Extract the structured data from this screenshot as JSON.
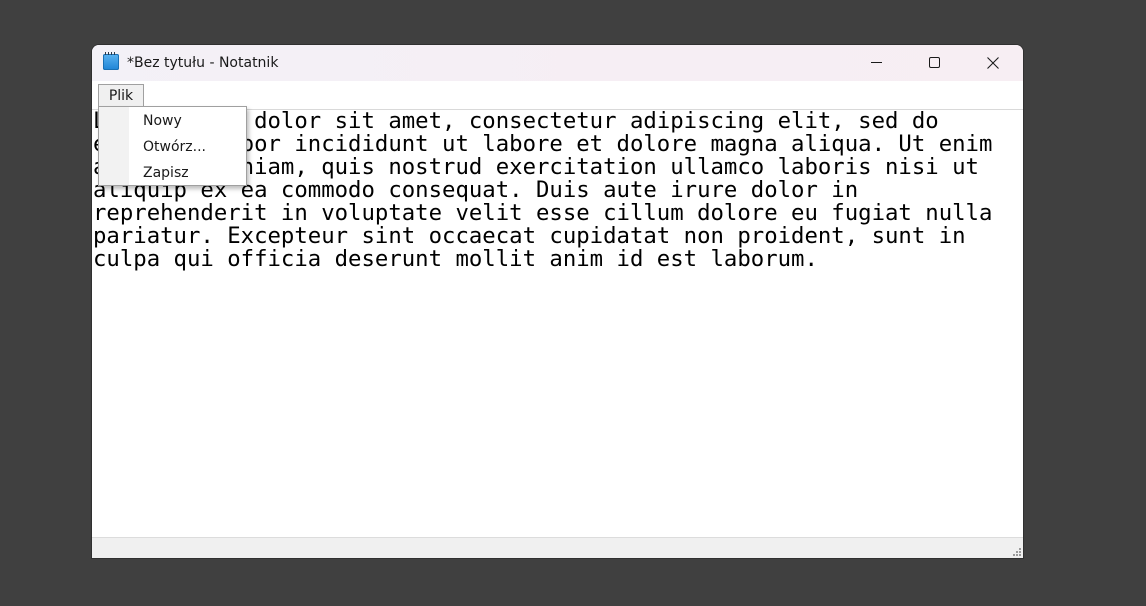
{
  "window": {
    "title": "*Bez tytułu - Notatnik",
    "accent_color": "#1e84d6"
  },
  "titlebar": {
    "icons": {
      "app": "notepad-icon",
      "minimize": "minimize-icon",
      "maximize": "maximize-icon",
      "close": "close-icon"
    }
  },
  "menubar": {
    "items": [
      {
        "label": "Plik",
        "open": true
      }
    ]
  },
  "dropdown": {
    "items": [
      {
        "label": "Nowy"
      },
      {
        "label": "Otwórz..."
      },
      {
        "label": "Zapisz"
      }
    ]
  },
  "editor": {
    "text": "Lorem ipsum dolor sit amet, consectetur adipiscing elit, sed do\neiusmod tempor incididunt ut labore et dolore magna aliqua. Ut enim\nad minim veniam, quis nostrud exercitation ullamco laboris nisi ut\naliquip ex ea commodo consequat. Duis aute irure dolor in\nreprehenderit in voluptate velit esse cillum dolore eu fugiat nulla\npariatur. Excepteur sint occaecat cupidatat non proident, sunt in\nculpa qui officia deserunt mollit anim id est laborum."
  },
  "statusbar": {
    "grip_icon": "resize-grip-icon"
  }
}
